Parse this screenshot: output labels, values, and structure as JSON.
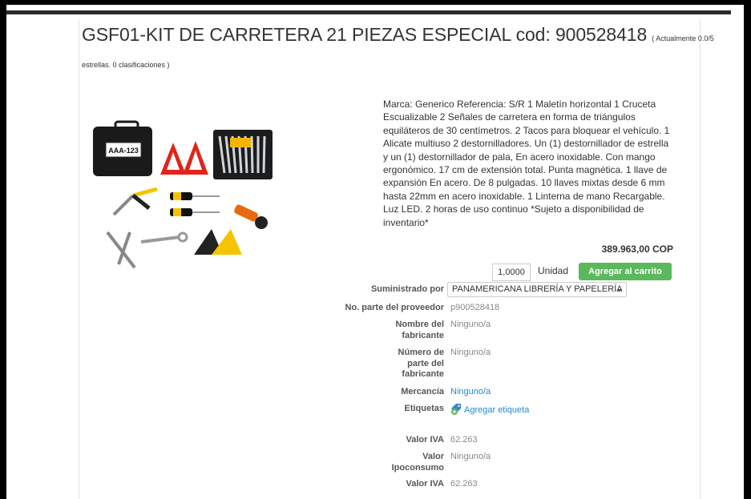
{
  "product": {
    "title": "GSF01-KIT DE CARRETERA 21 PIEZAS ESPECIAL cod: 900528418",
    "rating_part1": "( Actualmente 0.0/5",
    "rating_part2": "estrellas. 0 clasificaciones )",
    "description": "Marca: Generico Referencia: S/R 1 Maletín horizontal 1 Cruceta Escualizable 2 Señales de carretera en forma de triángulos equiláteros de 30 centímetros. 2 Tacos para bloquear el vehículo. 1 Alicate multiuso 2 destornilladores. Un (1) destornillador de estrella y un (1) destornillador de pala, En acero inoxidable. Con mango ergonómico. 17 cm de extensión total. Punta magnética. 1 llave de expansión En acero. De 8 pulgadas. 10 llaves mixtas desde 6 mm hasta 22mm en acero inoxidable. 1 Linterna de mano Recargable. Luz LED. 2 horas de uso continuo *Sujeto a disponibilidad de inventario*",
    "image_case_label": "AAA-123",
    "price": "389.963,00 COP"
  },
  "cart": {
    "quantity": "1,0000",
    "unit": "Unidad",
    "add_button": "Agregar al carrito"
  },
  "details": {
    "supplier_label": "Suministrado por",
    "supplier_value": "PANAMERICANA LIBRERÍA Y PAPELERÍA",
    "supplier_part_label": "No. parte del proveedor",
    "supplier_part_value": "p900528418",
    "manufacturer_name_label_1": "Nombre del",
    "manufacturer_name_label_2": "fabricante",
    "manufacturer_name_value": "Ninguno/a",
    "manufacturer_part_label_1": "Número de",
    "manufacturer_part_label_2": "parte del",
    "manufacturer_part_label_3": "fabricante",
    "manufacturer_part_value": "Ninguno/a",
    "commodity_label": "Mercancía",
    "commodity_value": "Ninguno/a",
    "tags_label": "Etiquetas",
    "tags_value": "Agregar etiqueta",
    "iva_label": "Valor IVA",
    "iva_value": "62.263",
    "ipo_label_1": "Valor",
    "ipo_label_2": "Ipoconsumo",
    "ipo_value": "Ninguno/a",
    "iva2_label": "Valor IVA",
    "iva2_value": "62.263"
  },
  "colors": {
    "add_button": "#5cb85c",
    "link": "#1f8ccf",
    "label": "#555555",
    "muted_value": "#888888"
  }
}
